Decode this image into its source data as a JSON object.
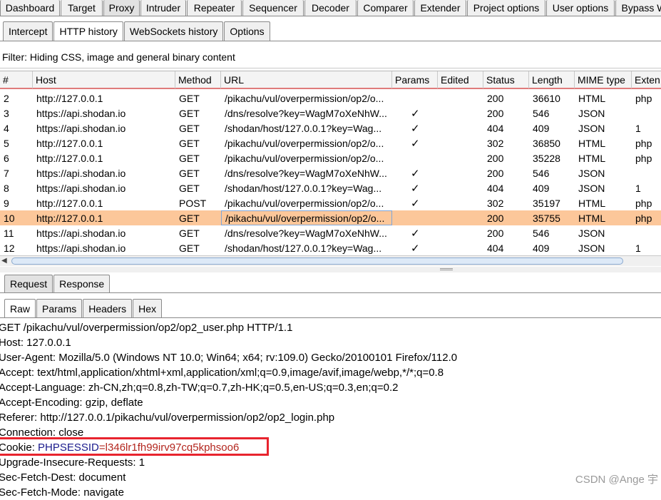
{
  "main_tabs": [
    {
      "label": "Dashboard",
      "width": 84
    },
    {
      "label": "Target",
      "width": 59
    },
    {
      "label": "Proxy",
      "width": 51,
      "active": true
    },
    {
      "label": "Intruder",
      "width": 64
    },
    {
      "label": "Repeater",
      "width": 77
    },
    {
      "label": "Sequencer",
      "width": 86
    },
    {
      "label": "Decoder",
      "width": 73
    },
    {
      "label": "Comparer",
      "width": 79
    },
    {
      "label": "Extender",
      "width": 73
    },
    {
      "label": "Project options",
      "width": 110
    },
    {
      "label": "User options",
      "width": 96
    },
    {
      "label": "Bypass W",
      "width": 80
    }
  ],
  "sub_tabs": [
    {
      "label": "Intercept"
    },
    {
      "label": "HTTP history",
      "active": true
    },
    {
      "label": "WebSockets history"
    },
    {
      "label": "Options"
    }
  ],
  "filter": "Filter: Hiding CSS, image and general binary content",
  "columns": [
    "#",
    "Host",
    "Method",
    "URL",
    "Params",
    "Edited",
    "Status",
    "Length",
    "MIME type",
    "Exten"
  ],
  "rows": [
    {
      "num": "2",
      "host": "http://127.0.0.1",
      "method": "GET",
      "url": "/pikachu/vul/overpermission/op2/o...",
      "params": "",
      "status": "200",
      "length": "36610",
      "mime": "HTML",
      "ext": "php"
    },
    {
      "num": "3",
      "host": "https://api.shodan.io",
      "method": "GET",
      "url": "/dns/resolve?key=WagM7oXeNhW...",
      "params": "✓",
      "status": "200",
      "length": "546",
      "mime": "JSON",
      "ext": ""
    },
    {
      "num": "4",
      "host": "https://api.shodan.io",
      "method": "GET",
      "url": "/shodan/host/127.0.0.1?key=Wag...",
      "params": "✓",
      "status": "404",
      "length": "409",
      "mime": "JSON",
      "ext": "1"
    },
    {
      "num": "5",
      "host": "http://127.0.0.1",
      "method": "GET",
      "url": "/pikachu/vul/overpermission/op2/o...",
      "params": "✓",
      "status": "302",
      "length": "36850",
      "mime": "HTML",
      "ext": "php"
    },
    {
      "num": "6",
      "host": "http://127.0.0.1",
      "method": "GET",
      "url": "/pikachu/vul/overpermission/op2/o...",
      "params": "",
      "status": "200",
      "length": "35228",
      "mime": "HTML",
      "ext": "php"
    },
    {
      "num": "7",
      "host": "https://api.shodan.io",
      "method": "GET",
      "url": "/dns/resolve?key=WagM7oXeNhW...",
      "params": "✓",
      "status": "200",
      "length": "546",
      "mime": "JSON",
      "ext": ""
    },
    {
      "num": "8",
      "host": "https://api.shodan.io",
      "method": "GET",
      "url": "/shodan/host/127.0.0.1?key=Wag...",
      "params": "✓",
      "status": "404",
      "length": "409",
      "mime": "JSON",
      "ext": "1"
    },
    {
      "num": "9",
      "host": "http://127.0.0.1",
      "method": "POST",
      "url": "/pikachu/vul/overpermission/op2/o...",
      "params": "✓",
      "status": "302",
      "length": "35197",
      "mime": "HTML",
      "ext": "php"
    },
    {
      "num": "10",
      "host": "http://127.0.0.1",
      "method": "GET",
      "url": "/pikachu/vul/overpermission/op2/o...",
      "params": "",
      "status": "200",
      "length": "35755",
      "mime": "HTML",
      "ext": "php",
      "selected": true
    },
    {
      "num": "11",
      "host": "https://api.shodan.io",
      "method": "GET",
      "url": "/dns/resolve?key=WagM7oXeNhW...",
      "params": "✓",
      "status": "200",
      "length": "546",
      "mime": "JSON",
      "ext": ""
    },
    {
      "num": "12",
      "host": "https://api.shodan.io",
      "method": "GET",
      "url": "/shodan/host/127.0.0.1?key=Wag...",
      "params": "✓",
      "status": "404",
      "length": "409",
      "mime": "JSON",
      "ext": "1"
    }
  ],
  "request_tabs": [
    {
      "label": "Request",
      "active": true
    },
    {
      "label": "Response"
    }
  ],
  "view_tabs": [
    {
      "label": "Raw",
      "active": true
    },
    {
      "label": "Params"
    },
    {
      "label": "Headers"
    },
    {
      "label": "Hex"
    }
  ],
  "request_lines": [
    "GET /pikachu/vul/overpermission/op2/op2_user.php HTTP/1.1",
    "Host: 127.0.0.1",
    "User-Agent: Mozilla/5.0 (Windows NT 10.0; Win64; x64; rv:109.0) Gecko/20100101 Firefox/112.0",
    "Accept: text/html,application/xhtml+xml,application/xml;q=0.9,image/avif,image/webp,*/*;q=0.8",
    "Accept-Language: zh-CN,zh;q=0.8,zh-TW;q=0.7,zh-HK;q=0.5,en-US;q=0.3,en;q=0.2",
    "Accept-Encoding: gzip, deflate",
    "Referer: http://127.0.0.1/pikachu/vul/overpermission/op2/op2_login.php",
    "Connection: close"
  ],
  "cookie": {
    "prefix": "Cookie: ",
    "name": "PHPSESSID",
    "eq": "=",
    "value": "l346lr1fh99irv97cq5kphsoo6"
  },
  "request_lines_after": [
    "Upgrade-Insecure-Requests: 1",
    "Sec-Fetch-Dest: document",
    "Sec-Fetch-Mode: navigate"
  ],
  "watermark": "CSDN @Ange 宇",
  "colors": {
    "selected_row": "#fcc79a",
    "highlight_box": "#e8242e",
    "header_underline": "#e07b7b"
  }
}
